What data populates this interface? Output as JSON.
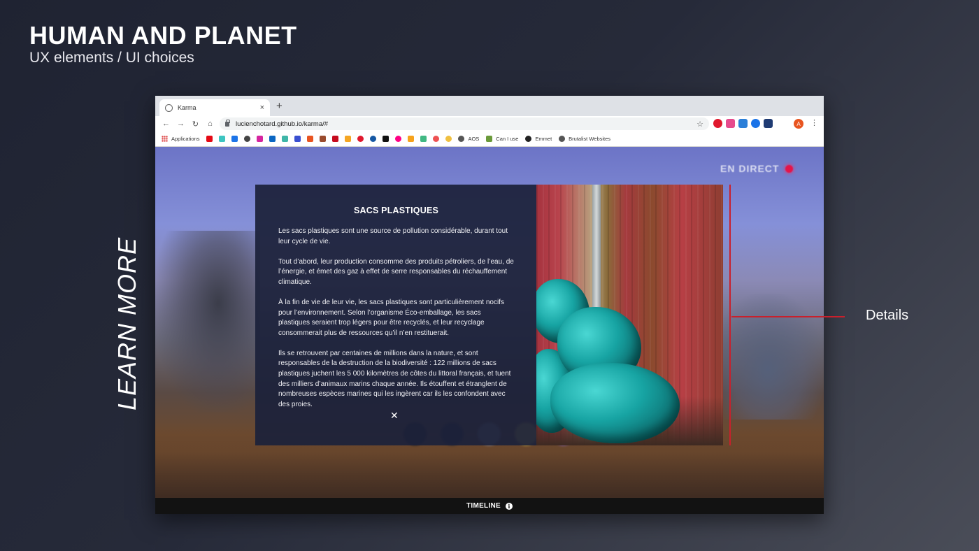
{
  "slide": {
    "title": "HUMAN AND PLANET",
    "subtitle": "UX elements / UI choices",
    "side_label": "LEARN MORE",
    "annotation_label": "Details",
    "accent_color": "#c9202c"
  },
  "browser": {
    "tab": {
      "title": "Karma",
      "close_label": "×"
    },
    "new_tab_label": "+",
    "nav": {
      "back": "←",
      "forward": "→",
      "reload": "↻",
      "home": "⌂"
    },
    "url": "lucienchotard.github.io/karma/#",
    "bookmark_star": "☆",
    "profile_initial": "A",
    "menu_label": "⋮",
    "bookmarks": [
      {
        "label": "Applications"
      },
      {
        "label": "AOS"
      },
      {
        "label": "Can I use"
      },
      {
        "label": "Emmet"
      },
      {
        "label": "Brutalist Websites"
      }
    ]
  },
  "page": {
    "live_badge": "EN DIRECT",
    "live_color": "#e4144a",
    "modal": {
      "title": "SACS PLASTIQUES",
      "paragraphs": [
        "Les sacs plastiques sont une source de pollution considérable, durant tout leur cycle de vie.",
        "Tout d’abord, leur production consomme des produits pétroliers, de l’eau, de l’énergie, et émet des gaz à effet de serre responsables du réchauffement climatique.",
        "À la fin de vie de leur vie, les sacs plastiques sont particulièrement nocifs pour l’environnement. Selon l’organisme Éco-emballage, les sacs plastiques seraient trop légers pour être recyclés, et leur recyclage consommerait plus de ressources qu’il n’en restituerait.",
        "Ils se retrouvent par centaines de millions dans la nature, et sont responsables de la destruction de la biodiversité : 122 millions de sacs plastiques juchent les 5 000 kilomètres de côtes du littoral français, et tuent des milliers d’animaux marins chaque année. Ils étouffent et étranglent de nombreuses espèces marines qui les ingèrent car ils les confondent avec des proies."
      ],
      "close_label": "✕"
    },
    "timeline_label": "TIMELINE",
    "info_glyph": "i"
  }
}
